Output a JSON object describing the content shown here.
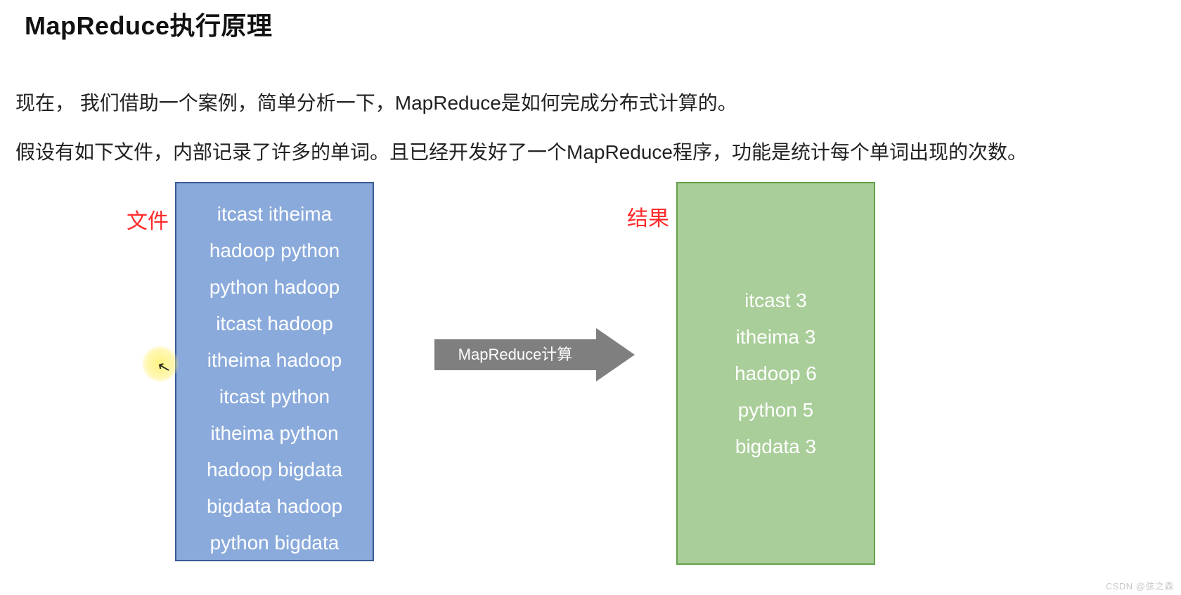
{
  "title": "MapReduce执行原理",
  "paragraph1": "现在，  我们借助一个案例，简单分析一下，MapReduce是如何完成分布式计算的。",
  "paragraph2": "假设有如下文件，内部记录了许多的单词。且已经开发好了一个MapReduce程序，功能是统计每个单词出现的次数。",
  "labels": {
    "file": "文件",
    "result": "结果"
  },
  "file_lines": [
    "itcast itheima",
    "hadoop python",
    "python hadoop",
    "itcast hadoop",
    "itheima hadoop",
    "itcast python",
    "itheima python",
    "hadoop bigdata",
    "bigdata hadoop",
    "python bigdata"
  ],
  "arrow_label": "MapReduce计算",
  "result_lines": [
    "itcast 3",
    "itheima 3",
    "hadoop 6",
    "python 5",
    "bigdata 3"
  ],
  "watermark": "CSDN @弦之森",
  "chart_data": {
    "type": "table",
    "title": "Word count via MapReduce",
    "input_words": [
      [
        "itcast",
        "itheima"
      ],
      [
        "hadoop",
        "python"
      ],
      [
        "python",
        "hadoop"
      ],
      [
        "itcast",
        "hadoop"
      ],
      [
        "itheima",
        "hadoop"
      ],
      [
        "itcast",
        "python"
      ],
      [
        "itheima",
        "python"
      ],
      [
        "hadoop",
        "bigdata"
      ],
      [
        "bigdata",
        "hadoop"
      ],
      [
        "python",
        "bigdata"
      ]
    ],
    "output_counts": {
      "itcast": 3,
      "itheima": 3,
      "hadoop": 6,
      "python": 5,
      "bigdata": 3
    }
  }
}
